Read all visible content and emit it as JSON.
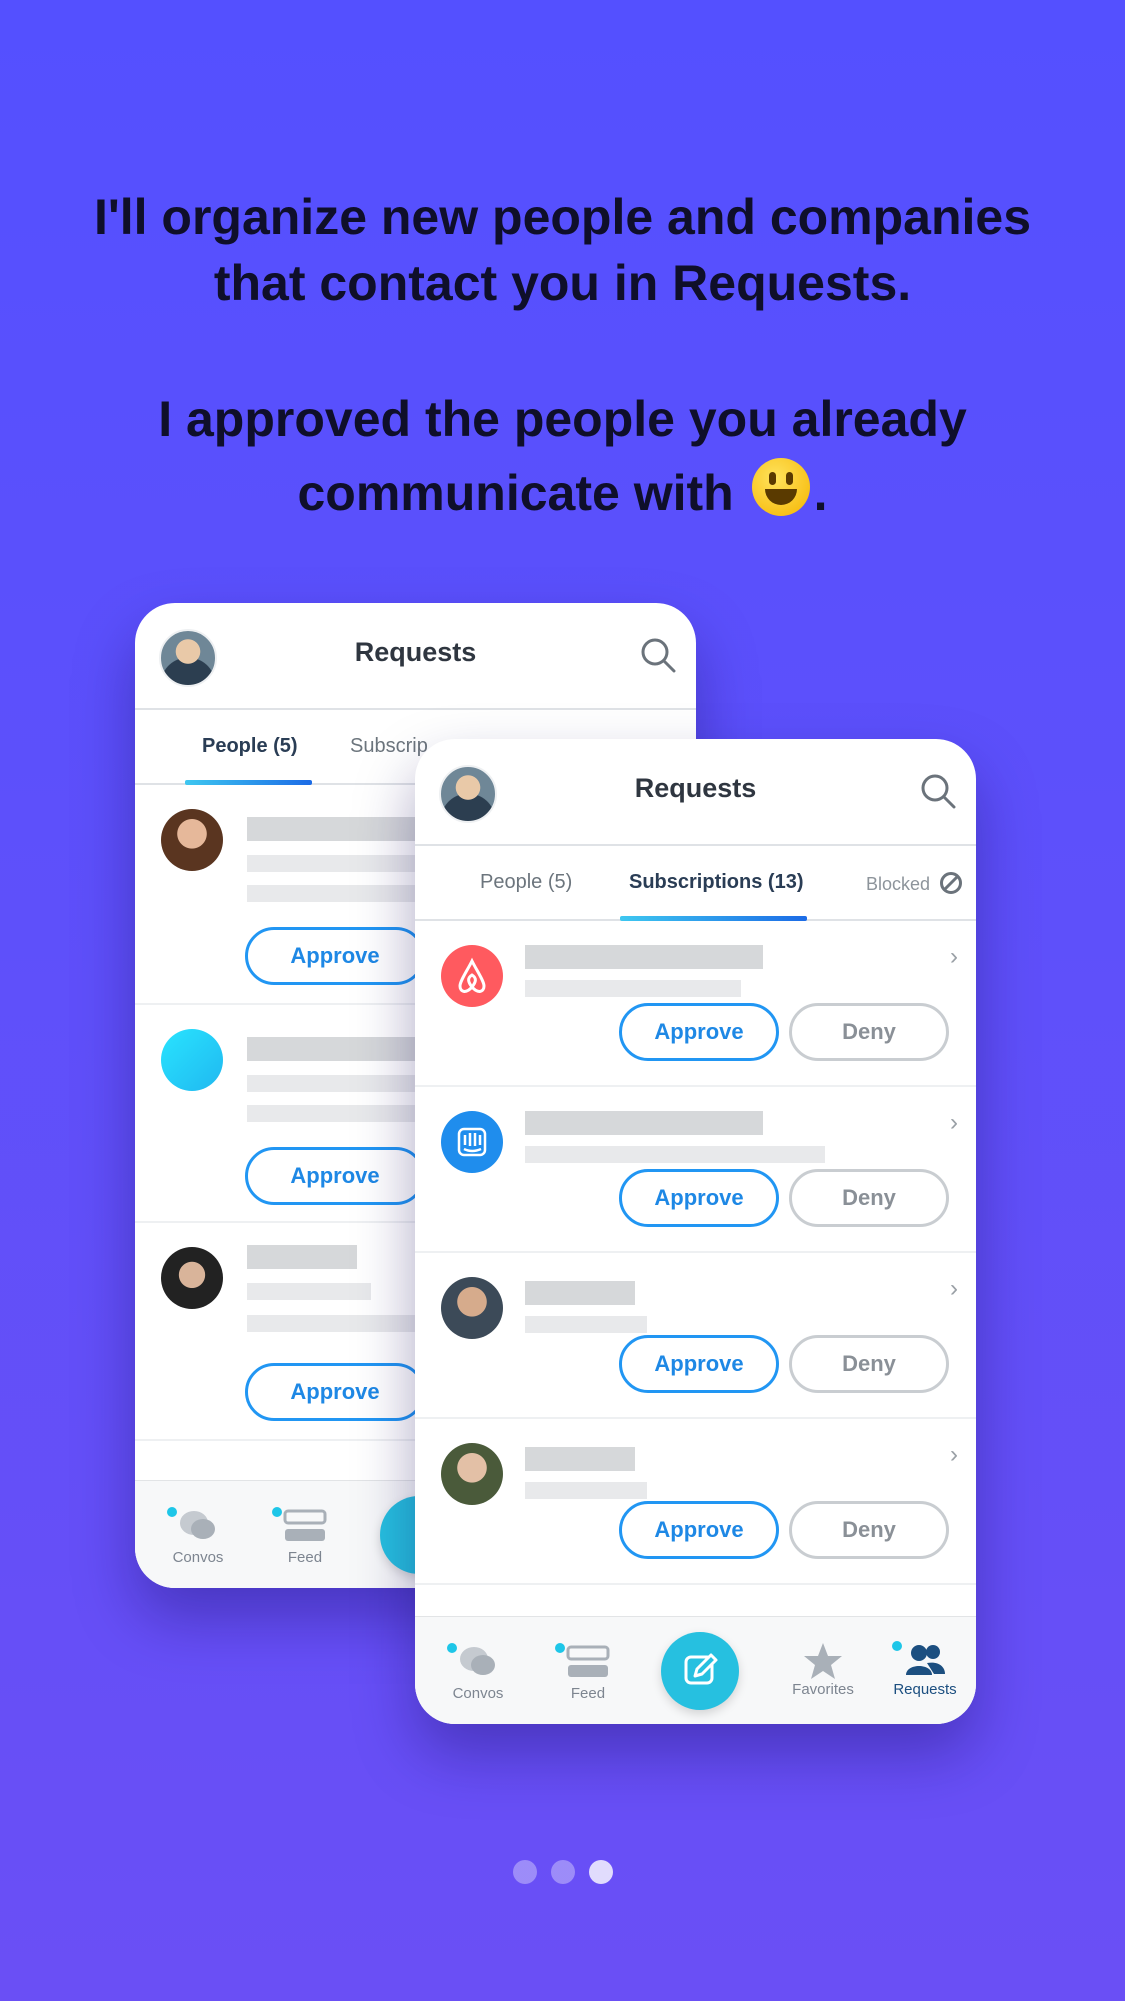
{
  "headline": {
    "line1": "I'll organize new people and companies",
    "line2": "that contact you in Requests.",
    "line3": "I approved the people you already",
    "line4": "communicate with",
    "line4_end": "."
  },
  "back_card": {
    "title": "Requests",
    "tabs": [
      "People (5)",
      "Subscrip"
    ],
    "approve_label": "Approve",
    "nav": [
      "Convos",
      "Feed"
    ]
  },
  "front_card": {
    "title": "Requests",
    "tabs": [
      "People (5)",
      "Subscriptions (13)",
      "Blocked"
    ],
    "approve_label": "Approve",
    "deny_label": "Deny",
    "nav": [
      "Convos",
      "Feed",
      "Favorites",
      "Requests"
    ]
  },
  "colors": {
    "background": "#5450ff",
    "accent": "#2196f3",
    "teal": "#26c0e0",
    "airbnb": "#ff5a5f",
    "intercom": "#1f8ded"
  },
  "pager": {
    "count": 3,
    "active": 3
  }
}
